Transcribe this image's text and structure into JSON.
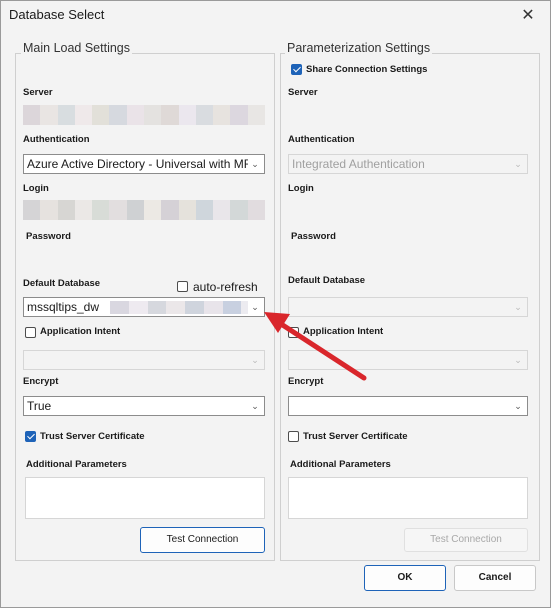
{
  "window": {
    "title": "Database Select",
    "close_glyph": "✕"
  },
  "main": {
    "title": "Main Load Settings",
    "server_label": "Server",
    "auth_label": "Authentication",
    "auth_value": "Azure Active Directory - Universal with MFA",
    "login_label": "Login",
    "password_label": "Password",
    "default_db_label": "Default Database",
    "auto_refresh_label": "auto-refresh",
    "auto_refresh_checked": false,
    "default_db_value": "mssqltips_dw",
    "app_intent_label": "Application Intent",
    "app_intent_checked": false,
    "encrypt_label": "Encrypt",
    "encrypt_value": "True",
    "trust_label": "Trust Server Certificate",
    "trust_checked": true,
    "additional_label": "Additional Parameters",
    "test_button": "Test Connection"
  },
  "param": {
    "title": "Parameterization Settings",
    "share_label": "Share Connection Settings",
    "share_checked": true,
    "server_label": "Server",
    "auth_label": "Authentication",
    "auth_value": "Integrated Authentication",
    "login_label": "Login",
    "password_label": "Password",
    "default_db_label": "Default Database",
    "app_intent_label": "Application Intent",
    "app_intent_checked": false,
    "encrypt_label": "Encrypt",
    "encrypt_value": "",
    "trust_label": "Trust Server Certificate",
    "trust_checked": false,
    "additional_label": "Additional Parameters",
    "test_button": "Test Connection"
  },
  "footer": {
    "ok_button": "OK",
    "cancel_button": "Cancel"
  },
  "colors": {
    "accent": "#1e63b8",
    "annotation_arrow": "#d9262b"
  },
  "icons": {
    "close": "close-icon",
    "chevron": "chevron-down-icon",
    "annotation": "red-arrow-annotation"
  }
}
